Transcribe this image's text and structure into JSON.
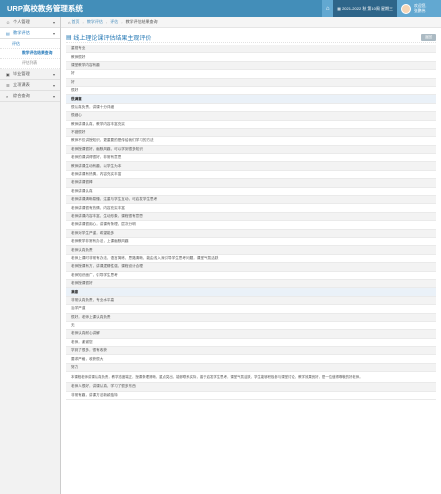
{
  "header": {
    "brand": "URP高校教务管理系统",
    "home_icon": "home-icon",
    "term": "2021-2022 秋 第10周 星期三",
    "user_line1": "欢迎您,",
    "user_line2": "张鹏伟"
  },
  "sidebar": {
    "items": [
      {
        "label": "个人管理",
        "icon": "user-icon"
      },
      {
        "label": "教学评估",
        "icon": "chart-icon"
      },
      {
        "label": "评估",
        "icon": ""
      },
      {
        "label": "教学评估结果查询",
        "icon": ""
      },
      {
        "label": "评估列表",
        "icon": ""
      },
      {
        "label": "毕业管理",
        "icon": "grad-icon"
      },
      {
        "label": "立项课表",
        "icon": "list-icon"
      },
      {
        "label": "综合查询",
        "icon": "search-icon"
      }
    ]
  },
  "breadcrumb": {
    "items": [
      "首页",
      "教学评估",
      "评估",
      "教学评估结果查询"
    ]
  },
  "main": {
    "title": "线上理论课评估结果主观评价",
    "back_label": "返回",
    "rows": [
      "重视专业",
      "教师很好",
      "课堂教学内容有趣",
      "好",
      "好",
      "很好",
      "很满意",
      "很认真负责，讲课十分详细",
      "很细心",
      "教师讲课认真，教学内容丰富充实",
      "不错很好",
      "教师不仅讲授知识，更重要的是传给我们学习的方法",
      "老师授课很好，幽默风趣，可以学到很多知识",
      "老师的课讲得很好，非常有意思",
      "教师讲课生动有趣，以学生为本",
      "老师讲课有热情，内容充实丰富",
      "老师讲课很棒",
      "老师讲课认真",
      "老师讲课清晰易懂，注重与学生互动，可启发学生思考",
      "老师讲课很有热情，内容充实丰富",
      "老师讲课内容丰富，生动形象，课程很有意思",
      "老师讲课很用心，讲课有条理，层次分明",
      "老师对学生严谨，希望能多",
      "老师教学非常有办法，上课幽默风趣",
      "老师认真负责",
      "老师上课时非常有办法，语言简练，思路清晰，能由浅入深引导学生思考问题，课堂气氛活跃",
      "老师授课有方，讲课逻辑性强，课程设计合理",
      "老师知识面广，引导学生思考",
      "老师授课很好",
      "满意",
      "非常认真负责，专业水平高",
      "治学严谨",
      "很好，老师上课认真负责",
      "无",
      "老师认真耐心讲解",
      "老师，谢谢您",
      "学到了很多，很有收获",
      "要求严格，收获很大",
      "努力",
      "本课程老师讲课认真负责，教学态度端正，授课条理清晰，重点突出，能够联系实际，善于启发学生思考，课堂气氛活跃，学生能够积极参与课堂讨论，教学效果良好，是一位值得尊敬的好老师。",
      "老师人很好，讲课认真，学习了很多东西",
      "非常有趣，讲课方法新颖独特"
    ]
  }
}
